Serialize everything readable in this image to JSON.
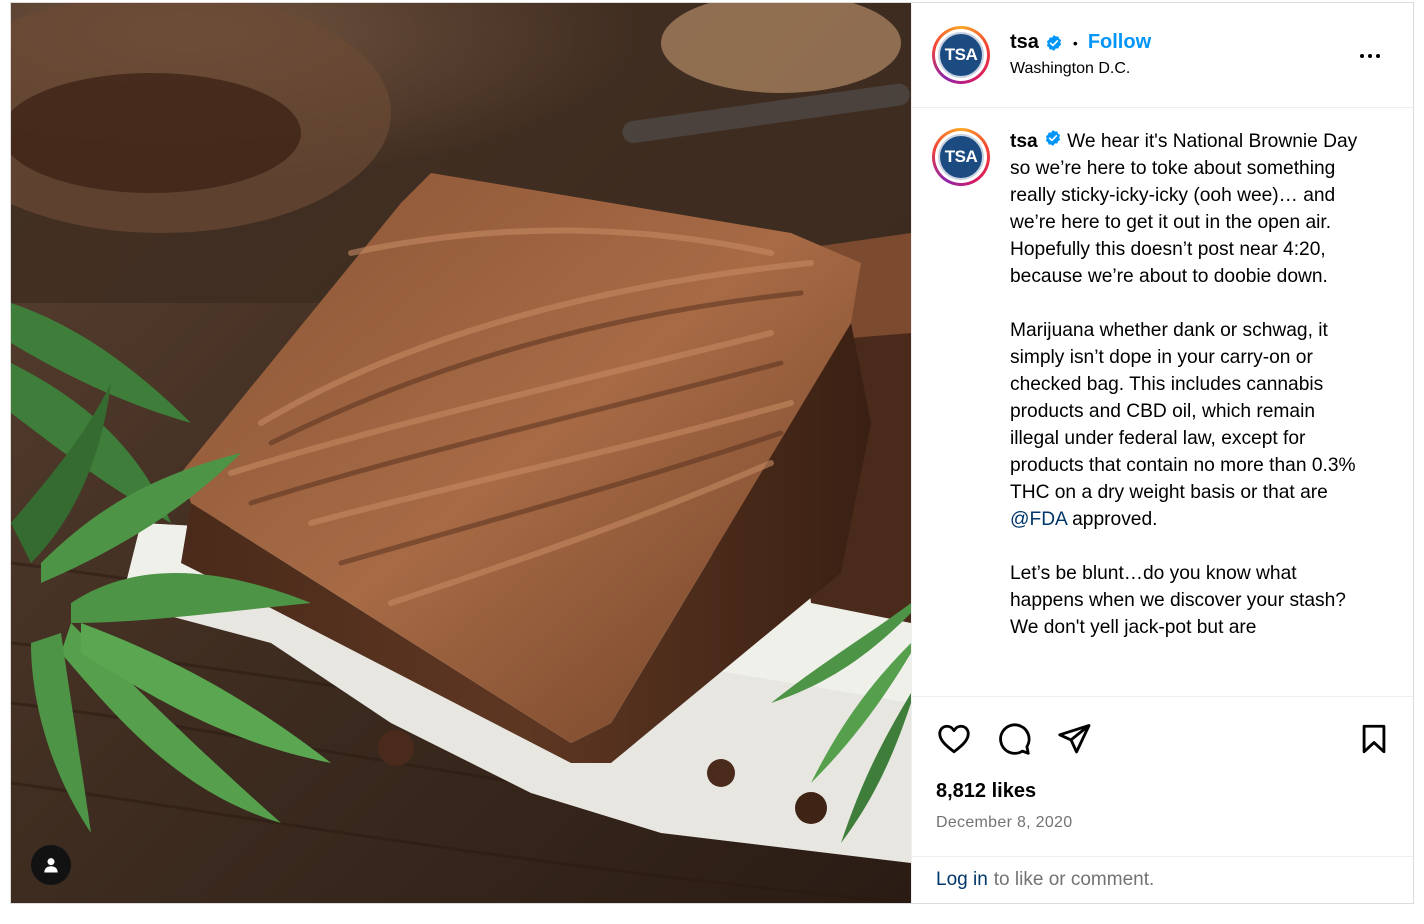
{
  "post": {
    "username": "tsa",
    "avatar_text": "TSA",
    "location": "Washington D.C.",
    "follow_label": "Follow",
    "separator": "•",
    "caption": {
      "username": "tsa",
      "p1": "We hear it's National Brownie Day so we’re here to toke about something really sticky-icky-icky (ooh wee)… and we’re here to get it out in the open air. Hopefully this doesn’t post near 4:20, because we’re about to doobie down.",
      "p2_before": "Marijuana whether dank or schwag, it simply isn’t dope in your carry-on or checked bag. This includes cannabis products and CBD oil, which remain illegal under federal law, except for products that contain no more than 0.3% THC on a dry weight basis or that are ",
      "mention": "@FDA",
      "p2_after": " approved.",
      "p3": "Let’s be blunt…do you know what happens when we discover your stash? We don't yell jack-pot but are"
    },
    "likes": "8,812 likes",
    "date": "December 8, 2020",
    "login": {
      "link": "Log in",
      "rest": "to like or comment."
    },
    "icons": {
      "like": "heart-icon",
      "comment": "comment-icon",
      "share": "share-icon",
      "save": "bookmark-icon",
      "more": "more-options-icon",
      "tag": "user-tag-icon",
      "verified": "verified-badge-icon"
    },
    "colors": {
      "accent": "#0095f6",
      "link": "#00376b",
      "avatar_bg": "#1c4b82",
      "muted": "#737373"
    }
  }
}
